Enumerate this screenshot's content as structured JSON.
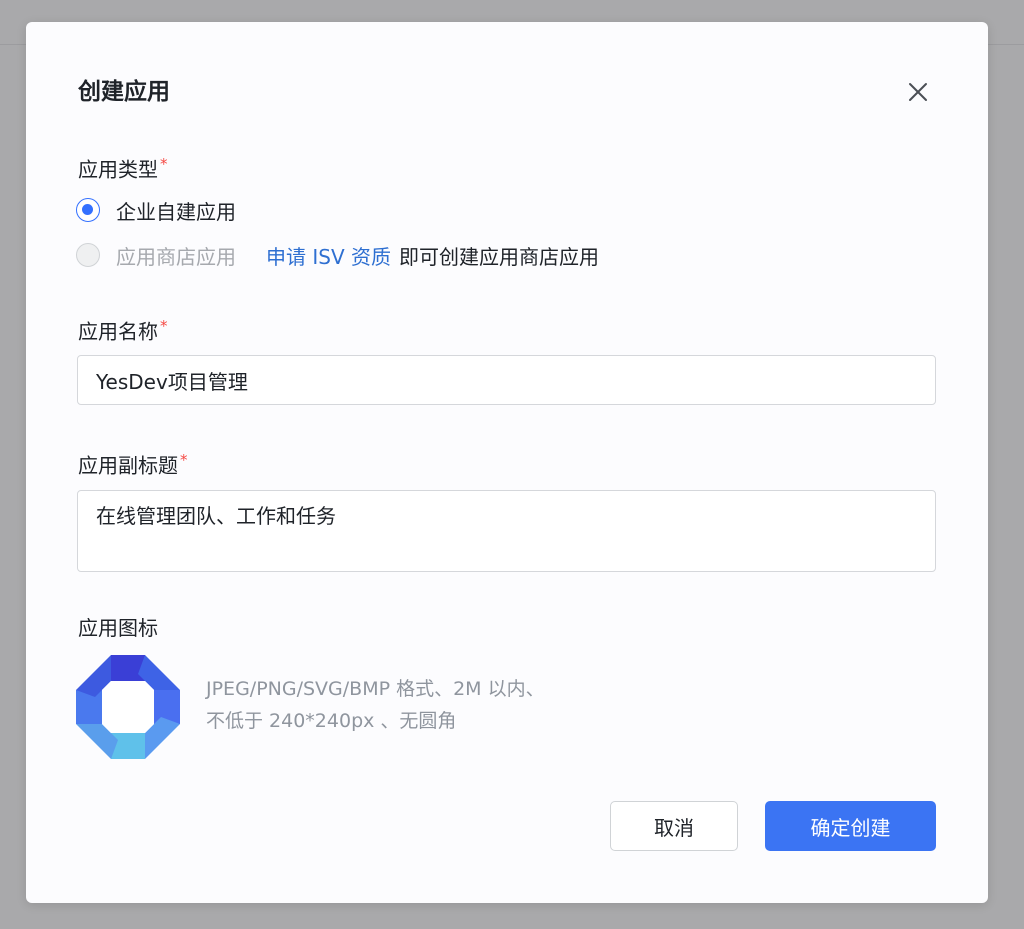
{
  "dialog": {
    "title": "创建应用"
  },
  "app_type": {
    "label": "应用类型",
    "required_mark": "*",
    "options": [
      {
        "label": "企业自建应用",
        "selected": true,
        "disabled": false
      },
      {
        "label": "应用商店应用",
        "selected": false,
        "disabled": true
      }
    ],
    "isv_link": "申请 ISV 资质",
    "isv_suffix": "即可创建应用商店应用"
  },
  "app_name": {
    "label": "应用名称",
    "required_mark": "*",
    "value": "YesDev项目管理"
  },
  "app_subtitle": {
    "label": "应用副标题",
    "required_mark": "*",
    "value": "在线管理团队、工作和任务"
  },
  "app_icon": {
    "label": "应用图标",
    "icon": "blue-octagon-logo",
    "hint_line1": "JPEG/PNG/SVG/BMP 格式、2M 以内、",
    "hint_line2": "不低于 240*240px 、无圆角"
  },
  "footer": {
    "cancel_label": "取消",
    "confirm_label": "确定创建"
  },
  "colors": {
    "primary": "#3b74f3",
    "link": "#2e6fd1",
    "required": "#f54a45",
    "hint_text": "#8f959e"
  }
}
